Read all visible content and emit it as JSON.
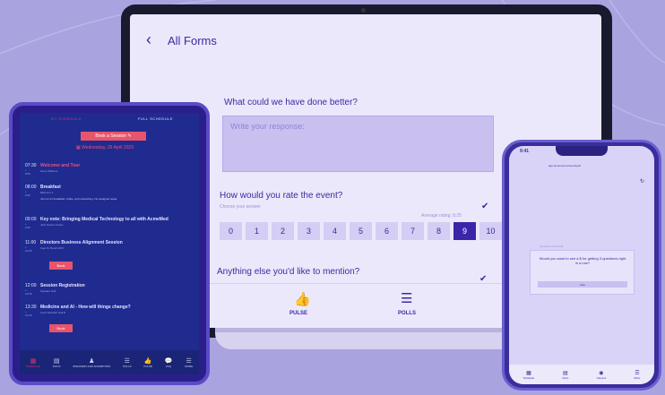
{
  "laptop": {
    "back_icon": "chevron-left-icon",
    "title": "All Forms",
    "question_1": "What could we have done better?",
    "response_placeholder": "Write your response:",
    "question_2": "How would you rate the event?",
    "choose_hint": "Choose your answer",
    "average_label": "Average rating: 8.25",
    "scale": [
      "0",
      "1",
      "2",
      "3",
      "4",
      "5",
      "6",
      "7",
      "8",
      "9",
      "10"
    ],
    "selected_value": "9",
    "question_3": "Anything else you'd like to mention?",
    "footer": {
      "pulse_label": "PULSE",
      "polls_label": "POLLS"
    }
  },
  "tablet": {
    "tab_my_schedule": "MY SCHEDULE",
    "tab_full_schedule": "FULL SCHEDULE",
    "book_session_label": "Book a Session",
    "date_label": "Wednesday, 26 April 2023",
    "sessions": [
      {
        "time": "07:30",
        "end": "+ 8:00",
        "title": "Welcome and Tour",
        "meta": "Harry Williams",
        "desc": ""
      },
      {
        "time": "08:00",
        "end": "+ 8:30",
        "title": "Breakfast",
        "meta": "Ballroom 2",
        "desc": "Join us for breakfast, coffee, and networking. No assigned seats."
      },
      {
        "time": "09:00",
        "end": "+ 9:30",
        "title": "Key note: Bringing Medical Technology to all with AcmeMed",
        "meta": "Jack Nelson Foster",
        "desc": ""
      },
      {
        "time": "11:00",
        "end": "+ 12:00",
        "title": "Directors Business Alignment Session",
        "meta": "Kate M.    Booth #467",
        "desc": ""
      },
      {
        "time": "12:00",
        "end": "+ 12:30",
        "title": "Session Registration",
        "meta": "Speaker Hall",
        "desc": ""
      },
      {
        "time": "13:30",
        "end": "+ 14:30",
        "title": "Medicine and AI - How will things change?",
        "meta": "Leah Standish    Hall B",
        "desc": ""
      }
    ],
    "book_button": "Book",
    "nav": [
      "SCHEDULE",
      "DOCS",
      "SPEAKERS AND EXHIBITORS",
      "POLLS",
      "PULSE",
      "FAQ",
      "MORE"
    ]
  },
  "phone": {
    "time": "9:41",
    "header": "app.acmemed.io/event/poll",
    "card_header": "Questions and Polls",
    "question": "Would you want to see a $ for getting 3 questions right in a row?",
    "vote_label": "Vote",
    "nav": [
      "Schedule",
      "Docs",
      "Camera",
      "More"
    ]
  },
  "colors": {
    "background": "#a9a3e0",
    "accent": "#3b25a8",
    "tablet_bg": "#1f2b8f",
    "pink": "#e8546b"
  }
}
